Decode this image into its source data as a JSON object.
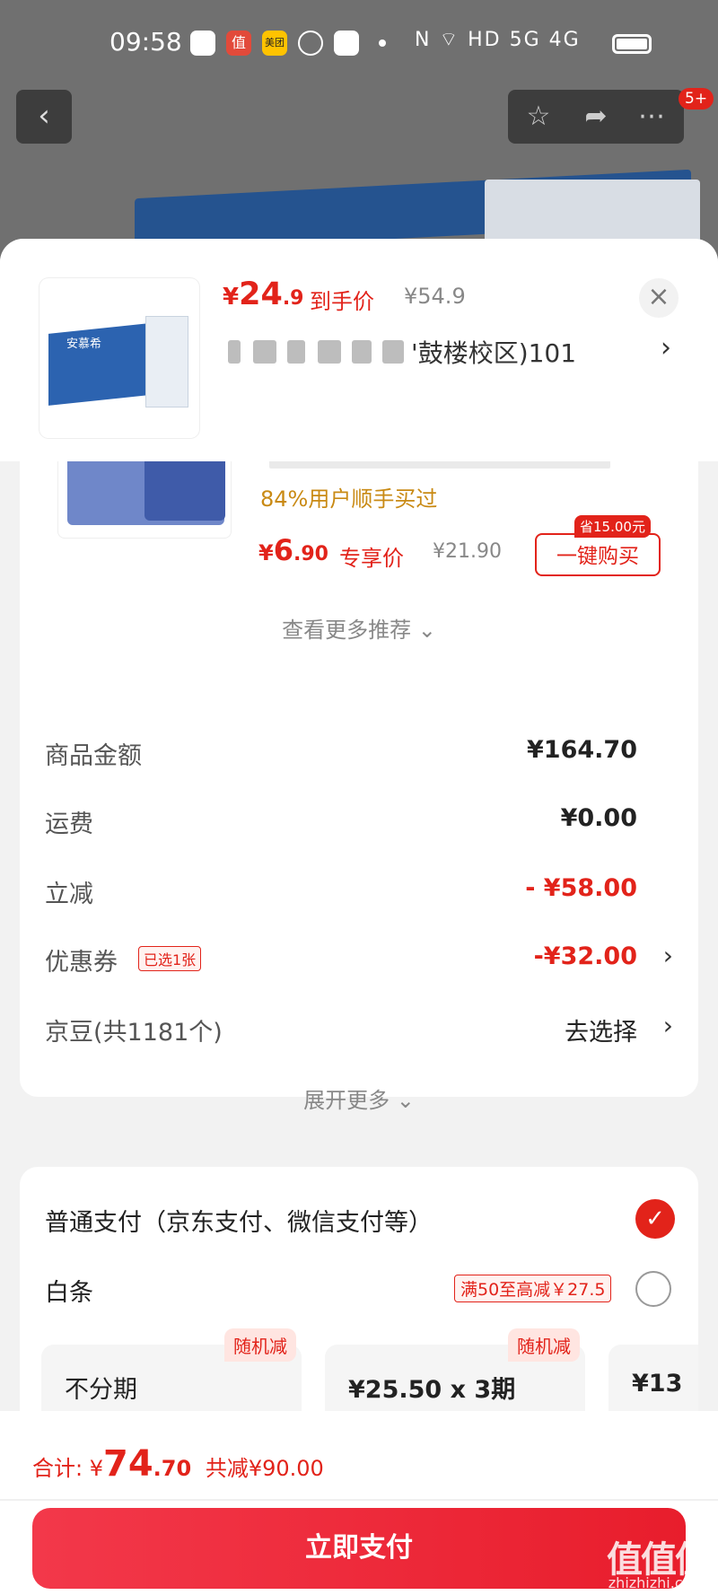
{
  "status_bar": {
    "time": "09:58",
    "right_text": "N  ⌔  HD  5G  4G",
    "app_icon_labels": [
      "",
      "值",
      "美团",
      "",
      ""
    ]
  },
  "top_nav": {
    "badge": "5+"
  },
  "sheet_header": {
    "price_symbol": "¥",
    "price_int": "24",
    "price_dec": ".9",
    "price_label": "到手价",
    "original_price": "¥54.9",
    "thumb_brand": "安慕希",
    "address": "'鼓楼校区)101"
  },
  "recommendation": {
    "buyers_note": "84%用户顺手买过",
    "price_symbol": "¥",
    "price_int": "6",
    "price_dec": ".90",
    "price_label": "专享价",
    "original_price": "¥21.90",
    "save_tag": "省15.00元",
    "buy_button": "一键购买",
    "more_label": "查看更多推荐 ⌄"
  },
  "summary": {
    "rows": [
      {
        "label": "商品金额",
        "value": "¥164.70"
      },
      {
        "label": "运费",
        "value": "¥0.00"
      },
      {
        "label": "立减",
        "value": "- ¥58.00"
      },
      {
        "label": "优惠券",
        "tag": "已选1张",
        "value": "-¥32.00"
      },
      {
        "label": "京豆(共1181个)",
        "value": "去选择"
      }
    ],
    "expand_label": "展开更多 ⌄"
  },
  "payment": {
    "normal_label": "普通支付（京东支付、微信支付等）",
    "baitiao_label": "白条",
    "baitiao_promo": "满50至高减￥27.5",
    "plans": [
      {
        "label": "不分期",
        "tag": "随机减"
      },
      {
        "label": "¥25.50 x 3期",
        "tag": "随机减"
      },
      {
        "label": "¥13",
        "tag": ""
      }
    ]
  },
  "bottom": {
    "total_label": "合计: ",
    "total_symbol": "¥",
    "total_int": "74",
    "total_dec": ".70",
    "discount_text": "共减¥90.00",
    "pay_button": "立即支付"
  },
  "watermark": {
    "text": "值值值",
    "url": "zhizhizhi.com"
  },
  "colors": {
    "accent": "#e2231a",
    "pay_button": "#f3384a",
    "coupon_text": "#c98a14"
  }
}
